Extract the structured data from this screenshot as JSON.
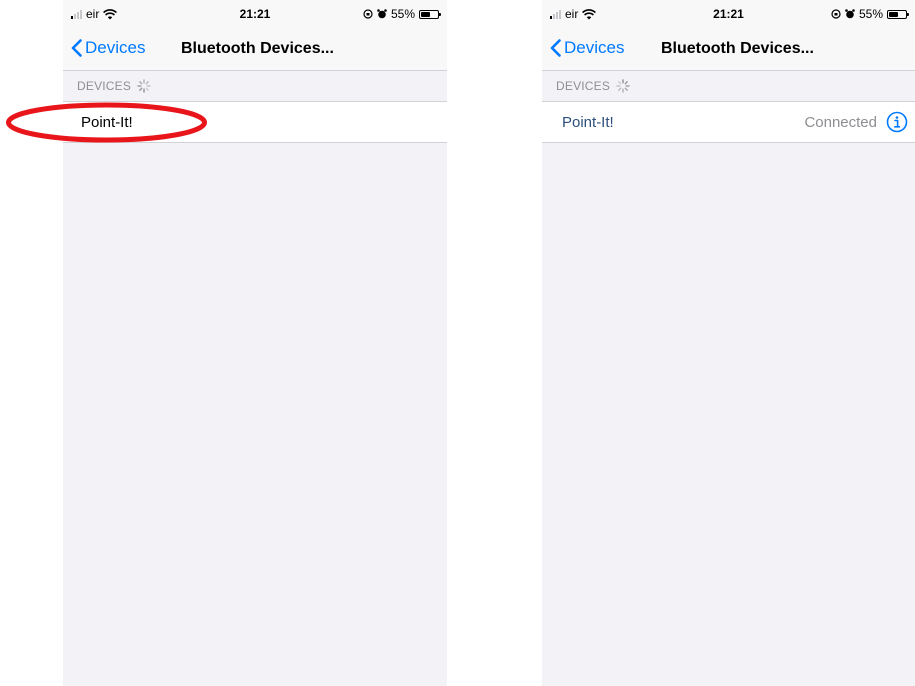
{
  "colors": {
    "accent": "#007aff",
    "annotation": "#e8161b",
    "background": "#f2f2f7"
  },
  "screens": [
    {
      "status_bar": {
        "carrier": "eir",
        "time": "21:21",
        "battery": "55%",
        "battery_level": 0.55
      },
      "nav": {
        "back_label": "Devices",
        "title": "Bluetooth Devices..."
      },
      "section_header": "DEVICES",
      "device": {
        "name": "Point-It!"
      },
      "annotation": "red-ellipse-highlight"
    },
    {
      "status_bar": {
        "carrier": "eir",
        "time": "21:21",
        "battery": "55%",
        "battery_level": 0.55
      },
      "nav": {
        "back_label": "Devices",
        "title": "Bluetooth Devices..."
      },
      "section_header": "DEVICES",
      "device": {
        "name": "Point-It!",
        "status": "Connected",
        "icon": "info-icon"
      }
    }
  ]
}
